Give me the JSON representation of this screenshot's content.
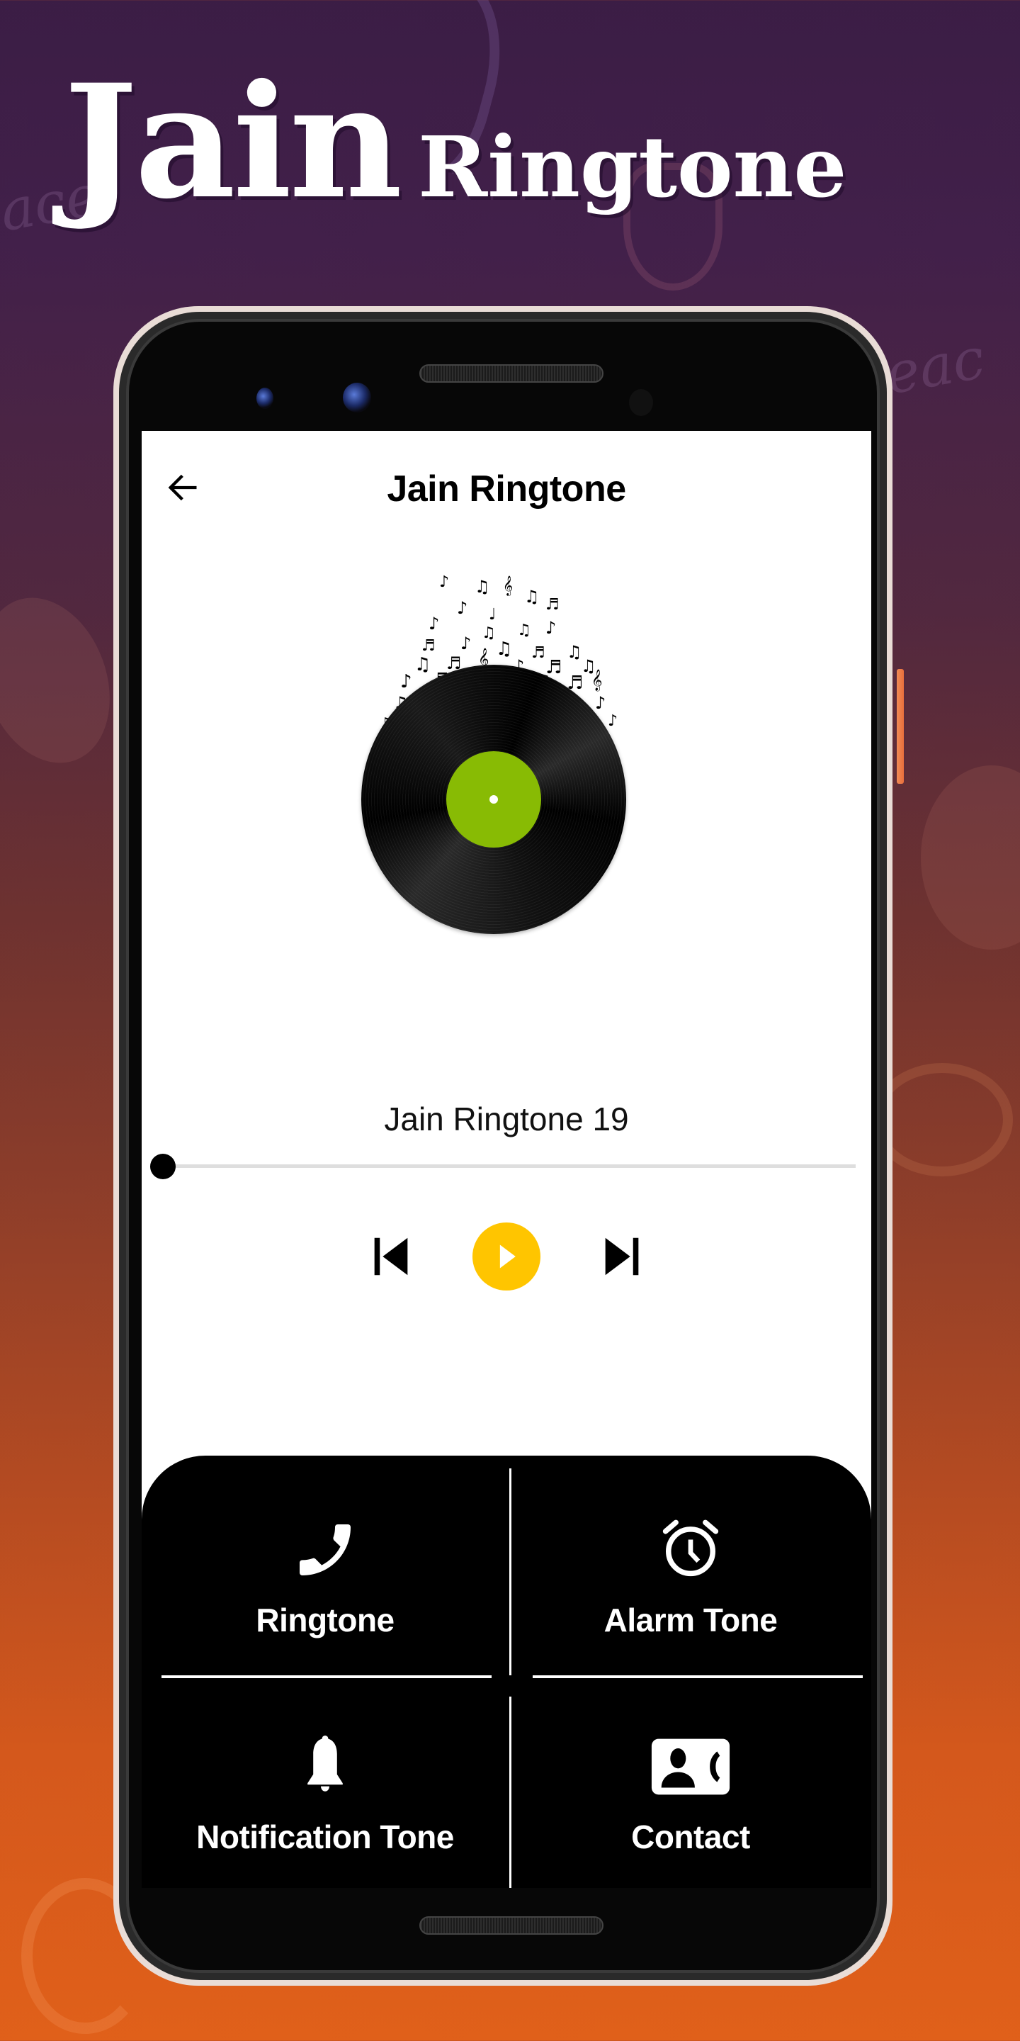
{
  "promo": {
    "title_word1": "Jain",
    "title_word2": "Ringtone"
  },
  "app_bar": {
    "back_icon": "arrow-left-icon",
    "title": "Jain Ringtone"
  },
  "player": {
    "artwork": "vinyl-record-with-music-notes",
    "track_name": "Jain Ringtone 19",
    "progress_fraction": 0.0,
    "controls": {
      "previous_icon": "skip-previous-icon",
      "play_icon": "play-icon",
      "next_icon": "skip-next-icon"
    },
    "accent_color": "#ffc500",
    "label_color": "#88bb04"
  },
  "actions": [
    {
      "label": "Ringtone",
      "icon": "phone-icon"
    },
    {
      "label": "Alarm Tone",
      "icon": "alarm-clock-icon"
    },
    {
      "label": "Notification Tone",
      "icon": "bell-icon"
    },
    {
      "label": "Contact",
      "icon": "contact-phone-icon"
    }
  ]
}
